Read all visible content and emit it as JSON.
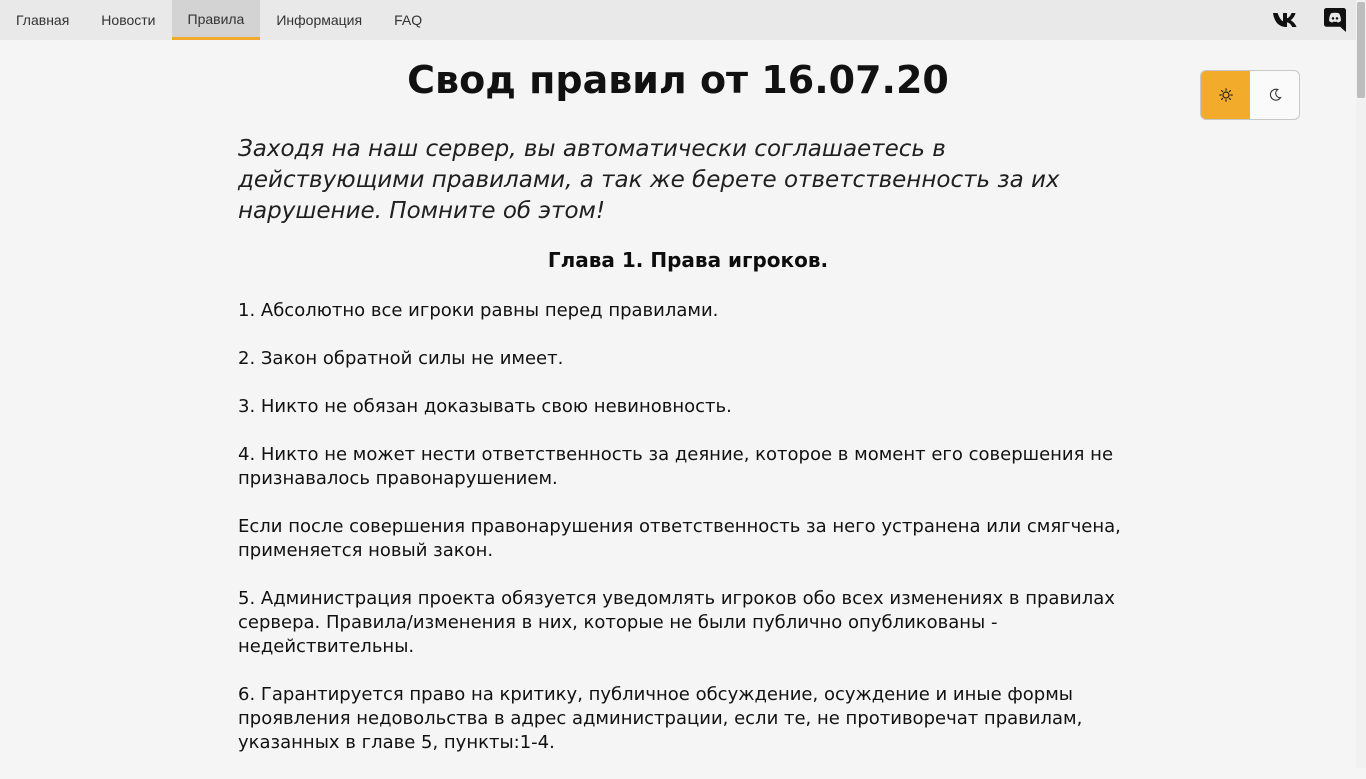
{
  "nav": {
    "items": [
      {
        "label": "Главная"
      },
      {
        "label": "Новости"
      },
      {
        "label": "Правила",
        "active": true
      },
      {
        "label": "Информация"
      },
      {
        "label": "FAQ"
      }
    ],
    "social": [
      {
        "icon": "vk-icon"
      },
      {
        "icon": "discord-icon"
      }
    ]
  },
  "colors": {
    "accent": "#f3ab2b",
    "nav_bg": "#e9e9e9",
    "page_bg": "#f5f5f5"
  },
  "theme_toggle": {
    "options": [
      {
        "icon": "sun-icon",
        "active": true
      },
      {
        "icon": "moon-icon",
        "active": false
      }
    ]
  },
  "page": {
    "title": "Свод правил от 16.07.20",
    "intro": "Заходя на наш сервер, вы автоматически соглашаетесь в действующими правилами, а так же берете ответственность за их нарушение. Помните об этом!",
    "chapter_title": "Глава 1. Права игроков.",
    "rules": [
      "1. Абсолютно все игроки равны перед правилами.",
      "2. Закон обратной силы не имеет.",
      "3. Никто не обязан доказывать свою невиновность.",
      "4. Никто не может нести ответственность за деяние, которое в момент его совершения не признавалось правонарушением.",
      "Если после совершения правонарушения ответственность за него устранена или смягчена, применяется новый закон.",
      "5. Администрация проекта обязуется уведомлять игроков обо всех изменениях в правилах сервера. Правила/изменения в них, которые не были публично опубликованы - недействительны.",
      "6. Гарантируется право на критику, публичное обсуждение, осуждение и иные формы проявления недовольства в адрес администрации, если те, не противоречат правилам, указанных в главе 5, пункты:1-4."
    ]
  }
}
